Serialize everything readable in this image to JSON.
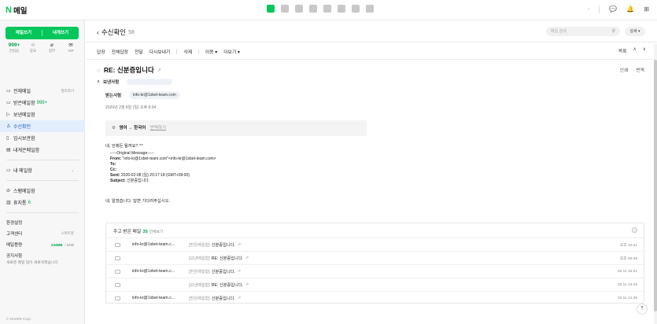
{
  "app": {
    "brand_n": "N",
    "brand_text": "메일"
  },
  "topbar": {
    "right": [
      "·",
      "💬",
      "🔔",
      "⊞"
    ]
  },
  "sidebar": {
    "compose": "메일쓰기",
    "self": "내게쓰기",
    "quick": [
      {
        "value": "999+",
        "label": "안읽음"
      },
      {
        "value": "☆",
        "label": "중요"
      },
      {
        "value": "⌀",
        "label": "첨부"
      },
      {
        "value": "✉",
        "label": "VIP"
      }
    ],
    "folders": [
      {
        "icon": "▭",
        "label": "전체메일",
        "count": "",
        "right": "정리하기"
      },
      {
        "icon": "▭",
        "label": "받은메일함",
        "count": "999+",
        "right": ""
      },
      {
        "icon": "▷",
        "label": "보낸메일함",
        "count": "",
        "right": ""
      },
      {
        "icon": "♙",
        "label": "수신확인",
        "count": "",
        "right": "",
        "active": true
      },
      {
        "icon": "▯",
        "label": "임시보관함",
        "count": "",
        "right": ""
      },
      {
        "icon": "▤",
        "label": "내게쓴메일함",
        "count": "",
        "right": ""
      }
    ],
    "mine": {
      "label": "내 메일함",
      "chev": "⌄"
    },
    "spam": {
      "label": "스팸메일함"
    },
    "trash": {
      "label": "휴지통",
      "count": "6"
    },
    "settings": "환경설정",
    "support": {
      "label": "고객센터",
      "right": "스마트봇"
    },
    "capacity": {
      "label": "메일용량",
      "used": "234MB",
      "total": "/ 5GB"
    },
    "notice": "공지사항",
    "notice_sub": "새로운 메일 업이 새로워졌습니다",
    "copyright": "© NAVER Corp."
  },
  "main": {
    "header": {
      "back": "‹",
      "title": "수신확인",
      "count": "58"
    },
    "search_placeholder": "메일 검색",
    "detail_button": "상세 ▾",
    "toolbar": [
      "답장",
      "전체답장",
      "전달",
      "다시보내기"
    ],
    "toolbar2": [
      "삭제"
    ],
    "toolbar3": [
      "이동 ▾",
      "더보기 ▾"
    ],
    "toolbar_right": [
      "목록",
      "∧",
      "∨"
    ],
    "subject": "RE: 신분증입니다",
    "subject_right": [
      "인쇄",
      "번역"
    ],
    "from_label": "보낸사람",
    "to_label": "받는사람",
    "to_chip": "info-kr@1xbet-team.com",
    "date": "2026년 2월 8일 (일) 오후 9:04",
    "translate": {
      "text": "영어 → 한국어",
      "link": "번역하기"
    },
    "body": {
      "greeting": "네, 언제든 될까요? ^^",
      "orig_header": "-----Original Message-----",
      "from_line_label": "From:",
      "from_line_value": " \"info-kr@1xbet-team.com\"<info-kr@1xbet-team.com>",
      "to_line_label": "To:",
      "cc_line_label": "Cc:",
      "sent_line_label": "Sent:",
      "sent_line_value": " 2026-02-08 (일) 20:17:18 (GMT+09:00)",
      "subject_line_label": "Subject:",
      "subject_line_value": " 신분증입니다.",
      "reply": "네, 알겠습니다. 답변 기다려주십시오."
    },
    "recent": {
      "title": "주고 받은 메일",
      "count": "35",
      "all": "전체보기",
      "help": "?",
      "rows": [
        {
          "from": "info-kr@1xbet-team.c...",
          "tag": "[받은메일함]",
          "subject": "신분증입니다.",
          "time": "오후 10:41"
        },
        {
          "from": "",
          "tag": "[보낸메일함]",
          "subject": "RE: 신분증입니다.",
          "time": "오후 09:49"
        },
        {
          "from": "info-kr@1xbet-team.c...",
          "tag": "[받은메일함]",
          "subject": "신분증입니다.",
          "time": "02.11 16:21"
        },
        {
          "from": "",
          "tag": "[보낸메일함]",
          "subject": "RE: 신분증입니다.",
          "time": "02.11 14:43"
        },
        {
          "from": "info-kr@1xbet-team.c...",
          "tag": "[받은메일함]",
          "subject": "신분증입니다.",
          "time": "02.11 14:35"
        }
      ]
    },
    "top_button": "⤒"
  }
}
